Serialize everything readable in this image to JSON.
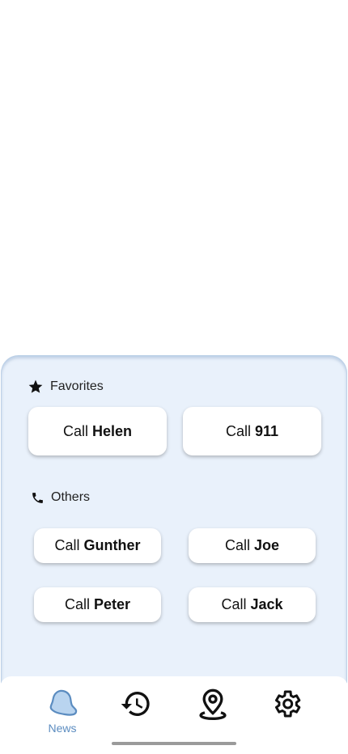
{
  "favorites": {
    "title": "Favorites",
    "buttons": [
      {
        "prefix": "Call",
        "name": "Helen"
      },
      {
        "prefix": "Call",
        "name": "911"
      }
    ]
  },
  "others": {
    "title": "Others",
    "buttons": [
      {
        "prefix": "Call",
        "name": "Gunther"
      },
      {
        "prefix": "Call",
        "name": "Joe"
      },
      {
        "prefix": "Call",
        "name": "Peter"
      },
      {
        "prefix": "Call",
        "name": "Jack"
      }
    ]
  },
  "nav": {
    "items": [
      {
        "icon": "bell-icon",
        "label": "News",
        "active": true
      },
      {
        "icon": "history-icon",
        "label": ""
      },
      {
        "icon": "location-pin-icon",
        "label": ""
      },
      {
        "icon": "gear-icon",
        "label": ""
      }
    ],
    "active_color": "#5b8cc0"
  },
  "colors": {
    "panel_bg": "#e9f1fb",
    "accent": "#5b8cc0"
  }
}
